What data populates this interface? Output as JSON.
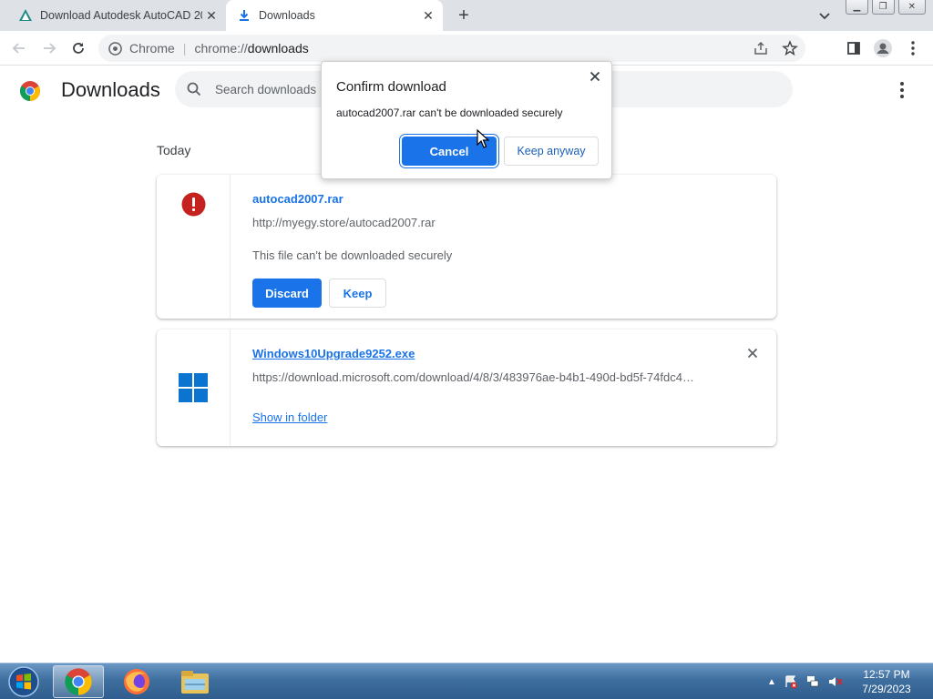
{
  "tabs": [
    {
      "title": "Download Autodesk AutoCAD 20",
      "active": false,
      "favicon": "autodesk-logo-icon"
    },
    {
      "title": "Downloads",
      "active": true,
      "favicon": "download-icon"
    }
  ],
  "omnibox": {
    "site_name": "Chrome",
    "url_scheme": "chrome://",
    "url_path": "downloads"
  },
  "page": {
    "title": "Downloads",
    "search_placeholder": "Search downloads",
    "date_heading": "Today"
  },
  "downloads": [
    {
      "filename": "autocad2007.rar",
      "url": "http://myegy.store/autocad2007.rar",
      "status": "This file can't be downloaded securely",
      "discard_label": "Discard",
      "keep_label": "Keep",
      "icon": "warning-icon"
    },
    {
      "filename": "Windows10Upgrade9252.exe",
      "url": "https://download.microsoft.com/download/4/8/3/483976ae-b4b1-490d-bd5f-74fdc4…",
      "show_in_folder_label": "Show in folder",
      "icon": "windows-logo-icon"
    }
  ],
  "dialog": {
    "title": "Confirm download",
    "message": "autocad2007.rar can't be downloaded securely",
    "cancel_label": "Cancel",
    "keep_label": "Keep anyway"
  },
  "taskbar": {
    "time": "12:57 PM",
    "date": "7/29/2023",
    "apps": [
      "chrome-icon",
      "firefox-icon",
      "file-explorer-icon"
    ]
  },
  "colors": {
    "accent": "#1a73e8",
    "warning": "#c5221f",
    "tabstrip": "#dee1e6"
  }
}
